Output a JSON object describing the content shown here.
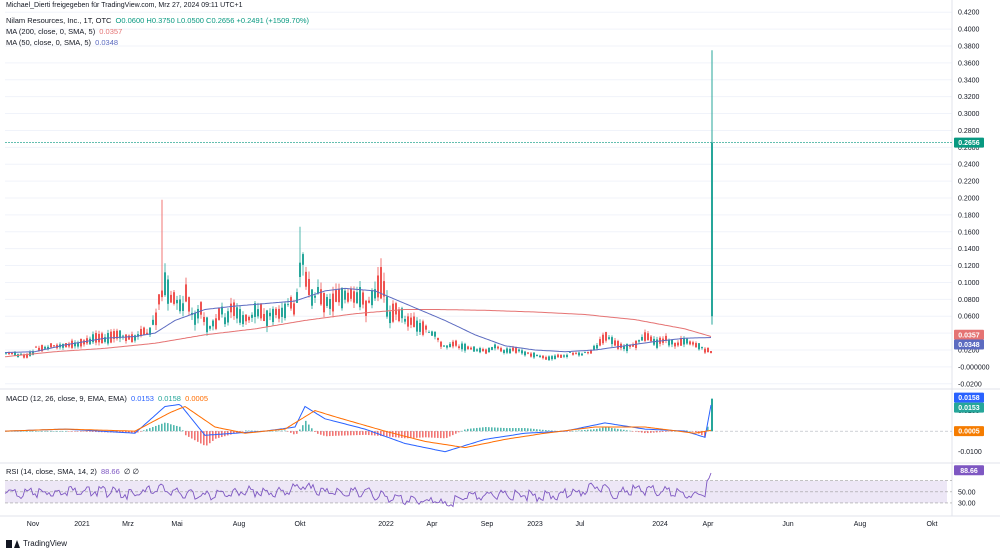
{
  "attribution": "Michael_Dierti freigegeben für TradingView.com, Mrz 27, 2024 09:11 UTC+1",
  "legend": {
    "symbol": "Nilam Resources, Inc., 1T, OTC",
    "ohlc": "O0.0600 H0.3750 L0.0500 C0.2656 +0.2491 (+1509.70%)",
    "ma200_label": "MA (200, close, 0, SMA, 5)",
    "ma200_value": "0.0357",
    "ma50_label": "MA (50, close, 0, SMA, 5)",
    "ma50_value": "0.0348",
    "macd_label": "MACD (12, 26, close, 9, EMA, EMA)",
    "macd_v1": "0.0153",
    "macd_v2": "0.0158",
    "macd_v3": "0.0005",
    "rsi_label": "RSI (14, close, SMA, 14, 2)",
    "rsi_value": "88.66",
    "rsi_extra": "∅ ∅"
  },
  "footer": {
    "brand": "TradingView"
  },
  "colors": {
    "up": "#26a69a",
    "down": "#ef5350",
    "ma200": "#e57373",
    "ma50": "#5c6bc0",
    "macd": "#2962ff",
    "signal": "#ff6d00",
    "rsi": "#7e57c2",
    "rsi_band": "#ede7f6",
    "price_badge": "#089981",
    "macd_hist_badge": "#f57c00"
  },
  "chart_data": {
    "type": "candlestick",
    "x_ticks": [
      "Nov",
      "2021",
      "Mrz",
      "Mai",
      "Aug",
      "Okt",
      "2022",
      "Apr",
      "Sep",
      "2023",
      "Jul",
      "2024",
      "Apr",
      "Jun",
      "Aug",
      "Okt"
    ],
    "price_axis": {
      "ticks": [
        "0.4200",
        "0.4000",
        "0.3800",
        "0.3600",
        "0.3400",
        "0.3200",
        "0.3000",
        "0.2800",
        "0.2600",
        "0.2400",
        "0.2200",
        "0.2000",
        "0.1800",
        "0.1600",
        "0.1400",
        "0.1200",
        "0.1000",
        "0.0800",
        "0.0600",
        "0.0400",
        "0.0200",
        "-0.000000",
        "-0.0200"
      ],
      "ylim": [
        -0.025,
        0.425
      ]
    },
    "last_price": "0.2656",
    "last_price_value": 0.2656,
    "ma200_value": 0.0357,
    "ma50_value": 0.0348,
    "price_anchors": [
      [
        0,
        0.017
      ],
      [
        10,
        0.016
      ],
      [
        20,
        0.014
      ],
      [
        30,
        0.022
      ],
      [
        40,
        0.025
      ],
      [
        50,
        0.028
      ],
      [
        60,
        0.03
      ],
      [
        70,
        0.031
      ],
      [
        80,
        0.034
      ],
      [
        90,
        0.038
      ],
      [
        100,
        0.036
      ],
      [
        110,
        0.042
      ],
      [
        120,
        0.04
      ],
      [
        130,
        0.04
      ],
      [
        140,
        0.045
      ],
      [
        150,
        0.06
      ],
      [
        155,
        0.098
      ],
      [
        160,
        0.11
      ],
      [
        165,
        0.086
      ],
      [
        170,
        0.09
      ],
      [
        175,
        0.078
      ],
      [
        180,
        0.09
      ],
      [
        185,
        0.07
      ],
      [
        190,
        0.065
      ],
      [
        195,
        0.075
      ],
      [
        200,
        0.055
      ],
      [
        205,
        0.05
      ],
      [
        210,
        0.06
      ],
      [
        215,
        0.07
      ],
      [
        220,
        0.062
      ],
      [
        225,
        0.075
      ],
      [
        230,
        0.07
      ],
      [
        240,
        0.06
      ],
      [
        250,
        0.072
      ],
      [
        260,
        0.065
      ],
      [
        270,
        0.07
      ],
      [
        280,
        0.075
      ],
      [
        290,
        0.08
      ],
      [
        295,
        0.14
      ],
      [
        300,
        0.12
      ],
      [
        305,
        0.095
      ],
      [
        310,
        0.09
      ],
      [
        320,
        0.08
      ],
      [
        330,
        0.085
      ],
      [
        340,
        0.09
      ],
      [
        350,
        0.095
      ],
      [
        360,
        0.08
      ],
      [
        370,
        0.095
      ],
      [
        375,
        0.11
      ],
      [
        380,
        0.085
      ],
      [
        385,
        0.065
      ],
      [
        390,
        0.075
      ],
      [
        395,
        0.07
      ],
      [
        400,
        0.06
      ],
      [
        410,
        0.055
      ],
      [
        420,
        0.05
      ],
      [
        430,
        0.04
      ],
      [
        440,
        0.025
      ],
      [
        450,
        0.03
      ],
      [
        460,
        0.025
      ],
      [
        470,
        0.022
      ],
      [
        480,
        0.02
      ],
      [
        490,
        0.025
      ],
      [
        500,
        0.02
      ],
      [
        510,
        0.022
      ],
      [
        520,
        0.018
      ],
      [
        530,
        0.015
      ],
      [
        540,
        0.012
      ],
      [
        550,
        0.013
      ],
      [
        560,
        0.015
      ],
      [
        570,
        0.018
      ],
      [
        580,
        0.016
      ],
      [
        590,
        0.025
      ],
      [
        600,
        0.04
      ],
      [
        610,
        0.03
      ],
      [
        620,
        0.025
      ],
      [
        630,
        0.03
      ],
      [
        640,
        0.04
      ],
      [
        650,
        0.03
      ],
      [
        660,
        0.035
      ],
      [
        670,
        0.03
      ],
      [
        680,
        0.035
      ],
      [
        690,
        0.028
      ],
      [
        700,
        0.022
      ],
      [
        705,
        0.021
      ]
    ],
    "ma200_anchors": [
      [
        0,
        0.012
      ],
      [
        50,
        0.018
      ],
      [
        100,
        0.022
      ],
      [
        150,
        0.028
      ],
      [
        200,
        0.038
      ],
      [
        250,
        0.045
      ],
      [
        300,
        0.055
      ],
      [
        350,
        0.063
      ],
      [
        400,
        0.068
      ],
      [
        430,
        0.068
      ],
      [
        480,
        0.067
      ],
      [
        530,
        0.065
      ],
      [
        580,
        0.062
      ],
      [
        630,
        0.056
      ],
      [
        680,
        0.045
      ],
      [
        707,
        0.0357
      ]
    ],
    "ma50_anchors": [
      [
        0,
        0.017
      ],
      [
        30,
        0.018
      ],
      [
        60,
        0.026
      ],
      [
        100,
        0.034
      ],
      [
        130,
        0.036
      ],
      [
        150,
        0.04
      ],
      [
        170,
        0.055
      ],
      [
        200,
        0.068
      ],
      [
        230,
        0.072
      ],
      [
        260,
        0.075
      ],
      [
        290,
        0.078
      ],
      [
        320,
        0.09
      ],
      [
        340,
        0.093
      ],
      [
        370,
        0.09
      ],
      [
        390,
        0.08
      ],
      [
        410,
        0.07
      ],
      [
        440,
        0.055
      ],
      [
        470,
        0.038
      ],
      [
        500,
        0.025
      ],
      [
        530,
        0.02
      ],
      [
        560,
        0.018
      ],
      [
        590,
        0.02
      ],
      [
        620,
        0.025
      ],
      [
        650,
        0.03
      ],
      [
        680,
        0.034
      ],
      [
        707,
        0.0348
      ]
    ],
    "spike": {
      "x": 707,
      "open": 0.06,
      "high": 0.375,
      "low": 0.05,
      "close": 0.2656
    },
    "macd": {
      "axis_ticks": [
        "0.0100",
        "-0.0100"
      ],
      "ylim": [
        -0.015,
        0.02
      ],
      "macd_anchors": [
        [
          0,
          0.0
        ],
        [
          60,
          0.001
        ],
        [
          130,
          -0.001
        ],
        [
          160,
          0.012
        ],
        [
          175,
          0.013
        ],
        [
          200,
          -0.002
        ],
        [
          230,
          -0.001
        ],
        [
          260,
          0.0
        ],
        [
          290,
          0.002
        ],
        [
          300,
          0.012
        ],
        [
          320,
          0.006
        ],
        [
          360,
          0.001
        ],
        [
          400,
          -0.006
        ],
        [
          440,
          -0.01
        ],
        [
          480,
          -0.004
        ],
        [
          520,
          -0.001
        ],
        [
          560,
          0.0
        ],
        [
          600,
          0.004
        ],
        [
          640,
          0.001
        ],
        [
          680,
          0.0
        ],
        [
          700,
          -0.003
        ],
        [
          707,
          0.0153
        ]
      ],
      "signal_anchors": [
        [
          0,
          0.0
        ],
        [
          60,
          0.001
        ],
        [
          130,
          0.0
        ],
        [
          165,
          0.009
        ],
        [
          180,
          0.012
        ],
        [
          210,
          0.002
        ],
        [
          240,
          -0.001
        ],
        [
          280,
          0.001
        ],
        [
          310,
          0.01
        ],
        [
          330,
          0.007
        ],
        [
          380,
          0.0
        ],
        [
          420,
          -0.005
        ],
        [
          460,
          -0.008
        ],
        [
          500,
          -0.004
        ],
        [
          540,
          -0.001
        ],
        [
          590,
          0.002
        ],
        [
          640,
          0.002
        ],
        [
          690,
          -0.001
        ],
        [
          707,
          0.0005
        ]
      ],
      "hist_end": 0.0158
    },
    "rsi": {
      "axis_ticks": [
        "50.00",
        "30.00"
      ],
      "ylim": [
        10,
        100
      ],
      "band": [
        30,
        70
      ],
      "anchors": [
        [
          0,
          54
        ],
        [
          30,
          52
        ],
        [
          60,
          58
        ],
        [
          100,
          55
        ],
        [
          130,
          50
        ],
        [
          155,
          62
        ],
        [
          165,
          55
        ],
        [
          200,
          48
        ],
        [
          240,
          56
        ],
        [
          280,
          54
        ],
        [
          295,
          66
        ],
        [
          320,
          52
        ],
        [
          360,
          55
        ],
        [
          380,
          45
        ],
        [
          400,
          40
        ],
        [
          430,
          38
        ],
        [
          440,
          32
        ],
        [
          460,
          45
        ],
        [
          500,
          50
        ],
        [
          540,
          47
        ],
        [
          580,
          55
        ],
        [
          590,
          66
        ],
        [
          610,
          52
        ],
        [
          630,
          60
        ],
        [
          660,
          55
        ],
        [
          690,
          48
        ],
        [
          700,
          55
        ],
        [
          707,
          88.66
        ]
      ]
    }
  }
}
